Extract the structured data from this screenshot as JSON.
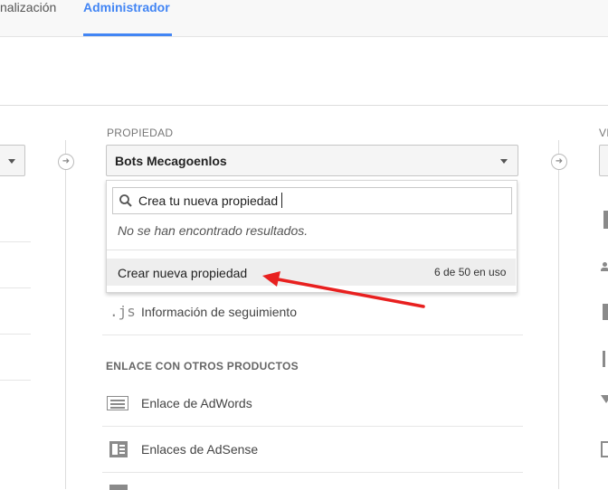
{
  "tabs": {
    "prev_label": "nalización",
    "admin_label": "Administrador"
  },
  "property": {
    "header": "PROPIEDAD",
    "selected": "Bots Mecagoenlos",
    "search_value": "Crea tu nueva propiedad",
    "no_results": "No se han encontrado resultados.",
    "create_label": "Crear nueva propiedad",
    "usage": "6 de 50 en uso"
  },
  "view": {
    "header_fragment": "VI"
  },
  "menu": {
    "tracking_icon_text": ".js",
    "tracking_label": "Información de seguimiento",
    "section_title": "ENLACE CON OTROS PRODUCTOS",
    "adwords_label": "Enlace de AdWords",
    "adsense_label": "Enlaces de AdSense"
  },
  "colors": {
    "accent": "#4285f4",
    "annotation_arrow": "#e8201f"
  }
}
